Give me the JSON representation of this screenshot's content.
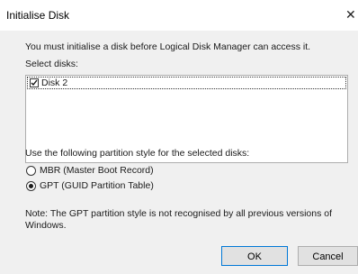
{
  "window": {
    "title": "Initialise Disk",
    "close_glyph": "✕"
  },
  "intro_text": "You must initialise a disk before Logical Disk Manager can access it.",
  "select_disks_label": "Select disks:",
  "disk_list": {
    "items": [
      {
        "label": "Disk 2",
        "checked": true
      }
    ]
  },
  "partition_style": {
    "label": "Use the following partition style for the selected disks:",
    "options": [
      {
        "label": "MBR (Master Boot Record)",
        "selected": false
      },
      {
        "label": "GPT (GUID Partition Table)",
        "selected": true
      }
    ]
  },
  "note": {
    "line1": "Note: The GPT partition style is not recognised by all previous versions of",
    "line2": "Windows."
  },
  "buttons": {
    "ok_label": "OK",
    "cancel_label": "Cancel"
  }
}
